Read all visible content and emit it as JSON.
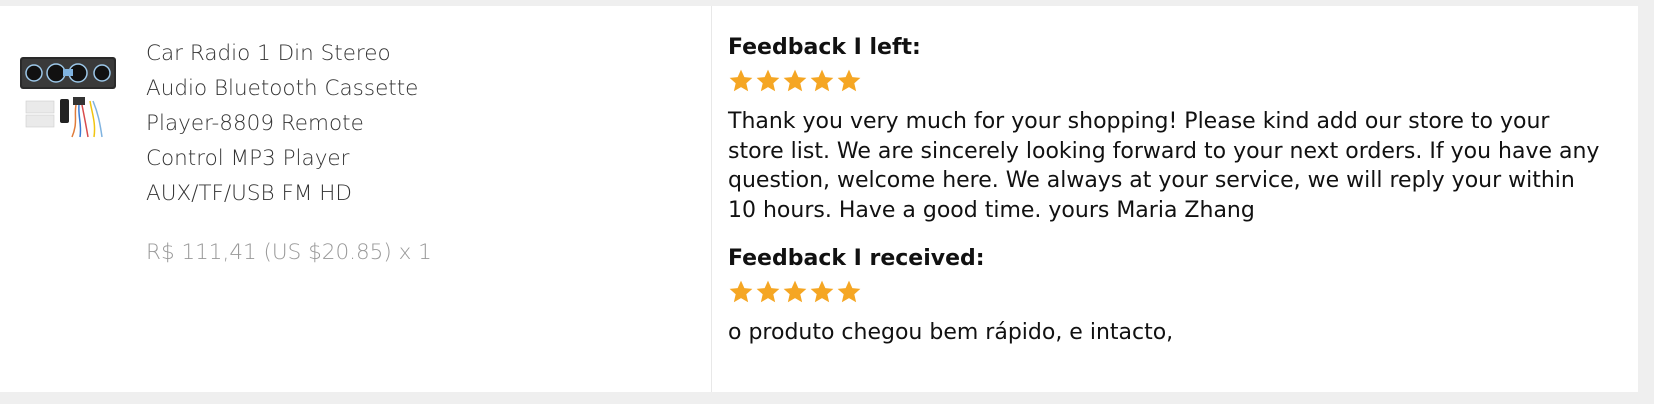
{
  "product": {
    "image_icon": "car-radio-product-thumbnail",
    "title": "Car Radio 1 Din Stereo Audio Bluetooth Cassette Player-8809 Remote Control MP3 Player AUX/TF/USB FM HD",
    "price": "R$ 111,41 (US $20.85) x 1"
  },
  "feedback_left": {
    "heading": "Feedback I left:",
    "rating": 5,
    "rating_max": 5,
    "text": "Thank you very much for your shopping! Please kind add our store to your store list. We are sincerely looking forward to your next orders. If you have any question, welcome here. We always at your service, we will reply your within 10 hours. Have a good time. yours Maria Zhang"
  },
  "feedback_received": {
    "heading": "Feedback I received:",
    "rating": 5,
    "rating_max": 5,
    "text": "o produto chegou bem rápido, e intacto,"
  },
  "colors": {
    "star": "#f5a623",
    "background": "#efefef",
    "card": "#ffffff",
    "price": "#999999"
  }
}
